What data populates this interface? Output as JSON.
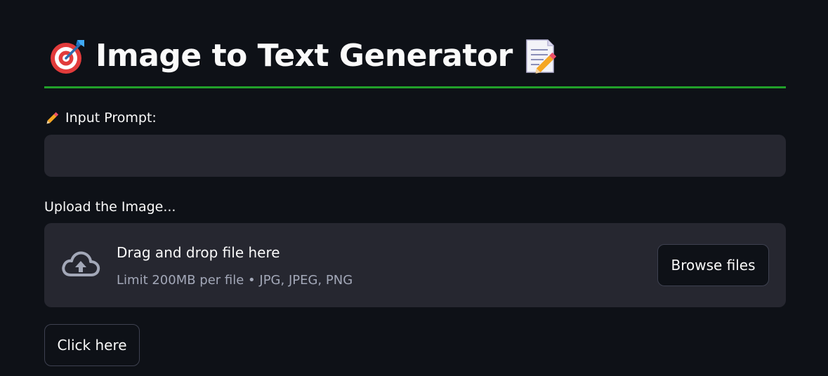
{
  "header": {
    "title": "Image to Text Generator",
    "left_icon": "dart-target-icon",
    "right_icon": "memo-pencil-icon",
    "divider_color": "#21a02a"
  },
  "prompt": {
    "label": "Input Prompt:",
    "label_icon": "pencil-icon",
    "value": "",
    "placeholder": ""
  },
  "upload": {
    "label": "Upload the Image...",
    "drop_title": "Drag and drop file here",
    "drop_subtitle": "Limit 200MB per file • JPG, JPEG, PNG",
    "upload_icon": "cloud-upload-icon",
    "browse_label": "Browse files"
  },
  "actions": {
    "submit_label": "Click here"
  },
  "colors": {
    "background": "#0e1117",
    "surface": "#262730",
    "text": "#fafafa",
    "muted_text": "#a3a8b8"
  }
}
